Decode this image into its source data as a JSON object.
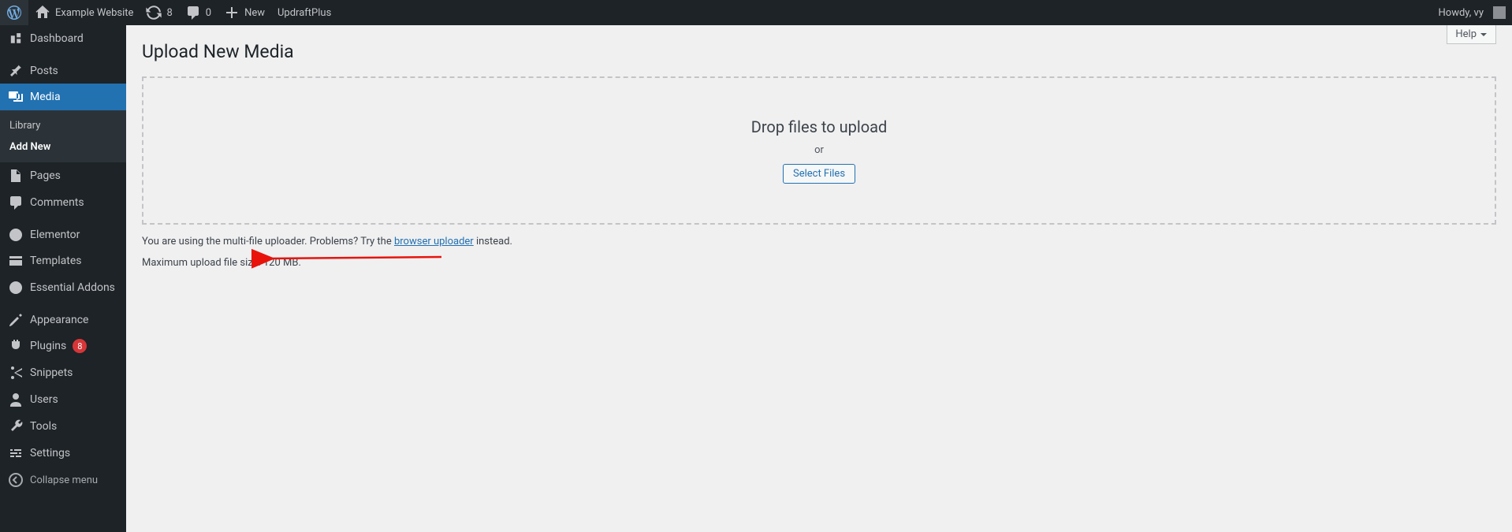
{
  "adminbar": {
    "site_name": "Example Website",
    "updates_count": "8",
    "comments_count": "0",
    "new_label": "New",
    "updraft_label": "UpdraftPlus",
    "howdy": "Howdy, vy"
  },
  "sidebar": {
    "dashboard": "Dashboard",
    "posts": "Posts",
    "media": "Media",
    "media_sub": {
      "library": "Library",
      "add_new": "Add New"
    },
    "pages": "Pages",
    "comments": "Comments",
    "elementor": "Elementor",
    "templates": "Templates",
    "essential_addons": "Essential Addons",
    "appearance": "Appearance",
    "plugins": "Plugins",
    "plugins_badge": "8",
    "snippets": "Snippets",
    "users": "Users",
    "tools": "Tools",
    "settings": "Settings",
    "collapse": "Collapse menu"
  },
  "main": {
    "title": "Upload New Media",
    "help": "Help",
    "drop_text": "Drop files to upload",
    "or": "or",
    "select_files": "Select Files",
    "info_prefix": "You are using the multi-file uploader. Problems? Try the ",
    "info_link": "browser uploader",
    "info_suffix": " instead.",
    "max_size": "Maximum upload file size: 120 MB."
  }
}
